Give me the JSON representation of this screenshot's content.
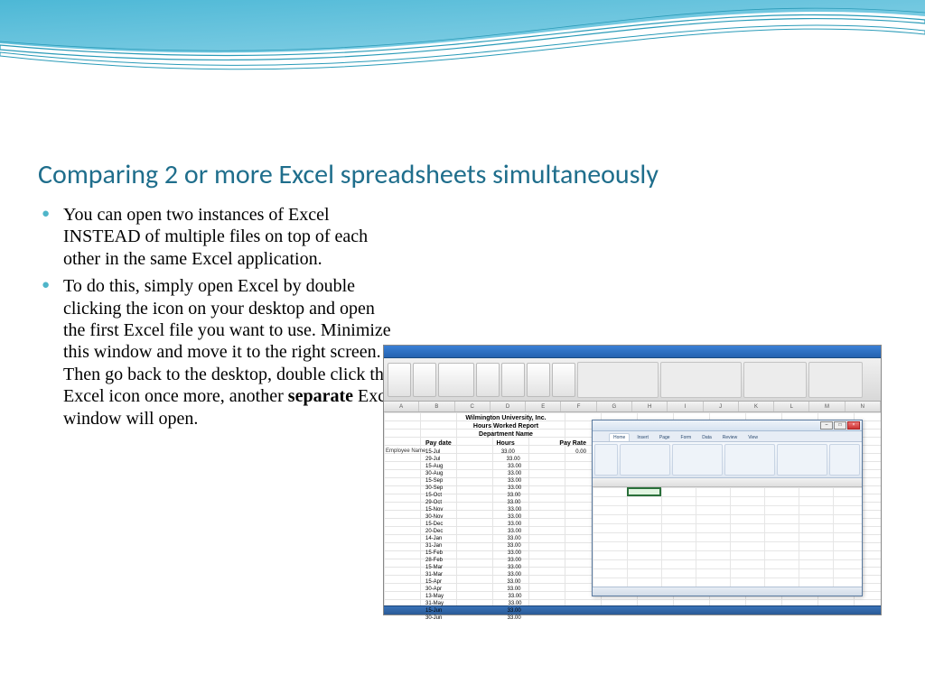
{
  "title": "Comparing 2 or more Excel spreadsheets simultaneously",
  "bullets": {
    "b1": "You can open two instances of Excel INSTEAD of multiple files on top of each other in the same Excel application.",
    "b2_pre": "To do this, simply open Excel by double clicking the icon on your desktop and open the first Excel file you want to use. Minimize this window and move it to the right screen. Then go back to the desktop, double click the Excel icon once more, another ",
    "b2_bold": "separate",
    "b2_post": " Excel window will open."
  },
  "excel": {
    "report_title1": "Wilmington University, Inc.",
    "report_title2": "Hours Worked Report",
    "report_title3": "Department Name",
    "col1": "Pay date",
    "col2": "Hours",
    "col3": "Pay Rate",
    "side": "Employee Name",
    "rows": [
      {
        "d": "15-Jul",
        "h": "33.00",
        "r": "0.00"
      },
      {
        "d": "29-Jul",
        "h": "33.00",
        "r": ""
      },
      {
        "d": "15-Aug",
        "h": "33.00",
        "r": ""
      },
      {
        "d": "30-Aug",
        "h": "33.00",
        "r": ""
      },
      {
        "d": "15-Sep",
        "h": "33.00",
        "r": ""
      },
      {
        "d": "30-Sep",
        "h": "33.00",
        "r": ""
      },
      {
        "d": "15-Oct",
        "h": "33.00",
        "r": ""
      },
      {
        "d": "29-Oct",
        "h": "33.00",
        "r": ""
      },
      {
        "d": "15-Nov",
        "h": "33.00",
        "r": ""
      },
      {
        "d": "30-Nov",
        "h": "33.00",
        "r": ""
      },
      {
        "d": "15-Dec",
        "h": "33.00",
        "r": ""
      },
      {
        "d": "20-Dec",
        "h": "33.00",
        "r": ""
      },
      {
        "d": "14-Jan",
        "h": "33.00",
        "r": ""
      },
      {
        "d": "31-Jan",
        "h": "33.00",
        "r": ""
      },
      {
        "d": "15-Feb",
        "h": "33.00",
        "r": ""
      },
      {
        "d": "28-Feb",
        "h": "33.00",
        "r": ""
      },
      {
        "d": "15-Mar",
        "h": "33.00",
        "r": ""
      },
      {
        "d": "31-Mar",
        "h": "33.00",
        "r": ""
      },
      {
        "d": "15-Apr",
        "h": "33.00",
        "r": ""
      },
      {
        "d": "30-Apr",
        "h": "33.00",
        "r": ""
      },
      {
        "d": "13-May",
        "h": "33.00",
        "r": ""
      },
      {
        "d": "31-May",
        "h": "33.00",
        "r": ""
      },
      {
        "d": "15-Jun",
        "h": "33.00",
        "r": ""
      },
      {
        "d": "30-Jun",
        "h": "33.00",
        "r": ""
      }
    ],
    "inner_tabs": [
      "Home",
      "Insert",
      "Page",
      "Form",
      "Data",
      "Review",
      "View"
    ]
  }
}
